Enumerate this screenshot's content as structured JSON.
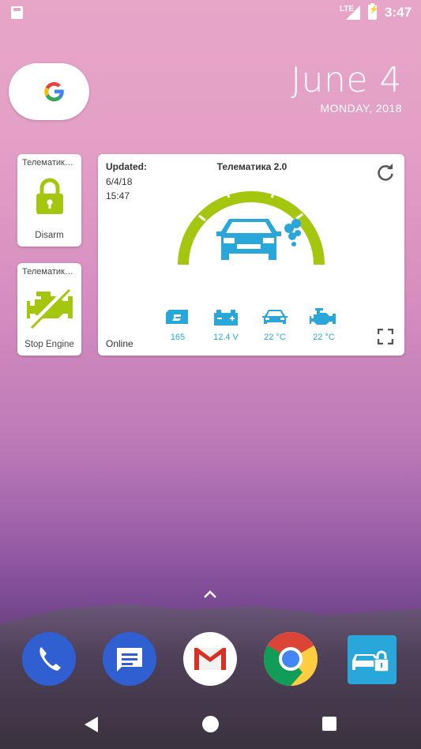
{
  "status": {
    "network": "LTE",
    "time": "3:47"
  },
  "date": {
    "day": "June 4",
    "sub": "MONDAY, 2018"
  },
  "widgets": {
    "small1": {
      "title": "Телематик…",
      "label": "Disarm"
    },
    "small2": {
      "title": "Телематик…",
      "label": "Stop Engine"
    },
    "main": {
      "updated_label": "Updated:",
      "date": "6/4/18",
      "time": "15:47",
      "title": "Телематика 2.0",
      "status": "Online",
      "metrics": [
        {
          "icon": "fuel-icon",
          "value": "165"
        },
        {
          "icon": "battery-icon",
          "value": "12.4 V"
        },
        {
          "icon": "car-temp-icon",
          "value": "22 °C"
        },
        {
          "icon": "engine-temp-icon",
          "value": "22 °C"
        }
      ]
    }
  },
  "colors": {
    "accent_green": "#a5c60e",
    "accent_blue": "#29a7db"
  },
  "dock": [
    {
      "name": "phone-app"
    },
    {
      "name": "messages-app"
    },
    {
      "name": "gmail-app"
    },
    {
      "name": "chrome-app"
    },
    {
      "name": "telematics-app"
    }
  ]
}
